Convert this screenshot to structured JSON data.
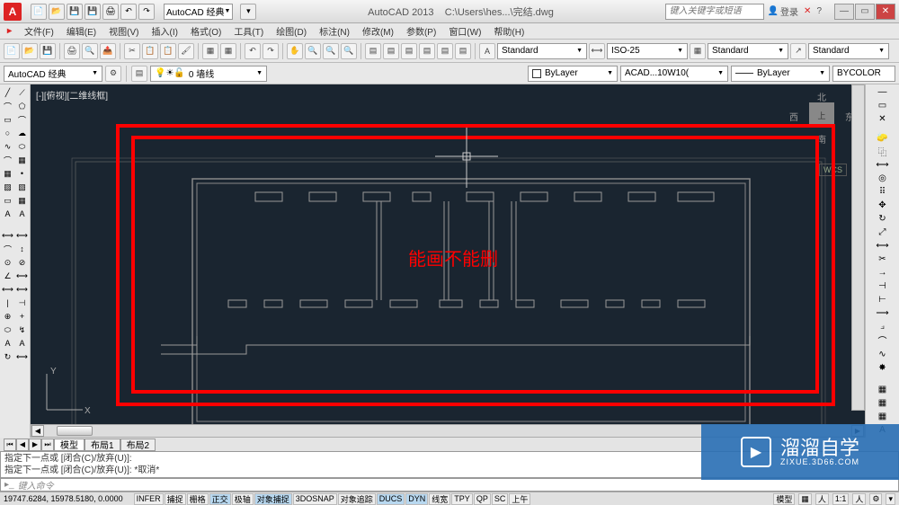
{
  "title_bar": {
    "app_name": "AutoCAD 2013",
    "file_path": "C:\\Users\\hes...\\完结.dwg",
    "workspace": "AutoCAD 经典",
    "search_placeholder": "键入关键字或短语",
    "sign_in": "登录"
  },
  "menu": [
    "文件(F)",
    "编辑(E)",
    "视图(V)",
    "插入(I)",
    "格式(O)",
    "工具(T)",
    "绘图(D)",
    "标注(N)",
    "修改(M)",
    "参数(P)",
    "窗口(W)",
    "帮助(H)"
  ],
  "styles": {
    "text_style": "Standard",
    "dim_style": "ISO-25",
    "table_style": "Standard",
    "mleader_style": "Standard"
  },
  "layer": {
    "workspace_combo": "AutoCAD 经典",
    "current_layer": "0 墙线",
    "color": "ByLayer",
    "linetype": "ACAD...10W10(",
    "lineweight": "ByLayer",
    "plot_style": "BYCOLOR"
  },
  "viewport": {
    "label": "[-][俯视][二维线框]",
    "nav": {
      "n": "北",
      "s": "南",
      "e": "东",
      "w": "西",
      "top": "上",
      "wcs": "WCS"
    },
    "annotation_text": "能画不能删",
    "ucs": {
      "x": "X",
      "y": "Y"
    }
  },
  "tabs": {
    "nav_btns": [
      "⏮",
      "◀",
      "▶",
      "⏭"
    ],
    "items": [
      "模型",
      "布局1",
      "布局2"
    ],
    "active": 0
  },
  "command": {
    "history": [
      "指定下一点或 [闭合(C)/放弃(U)]:",
      "指定下一点或 [闭合(C)/放弃(U)]: *取消*"
    ],
    "prompt": "键入命令"
  },
  "status": {
    "coords": "19747.6284, 15978.5180, 0.0000",
    "toggles": [
      "INFER",
      "捕捉",
      "栅格",
      "正交",
      "极轴",
      "对象捕捉",
      "3DOSNAP",
      "对象追踪",
      "DUCS",
      "DYN",
      "线宽",
      "TPY",
      "QP",
      "SC",
      "上午"
    ],
    "toggle_on": [
      3,
      5,
      8,
      9
    ],
    "right": {
      "model": "模型",
      "anno": "1:1",
      "extra": "⚙"
    }
  },
  "watermark": {
    "main": "溜溜自学",
    "sub": "ZIXUE.3D66.COM"
  }
}
